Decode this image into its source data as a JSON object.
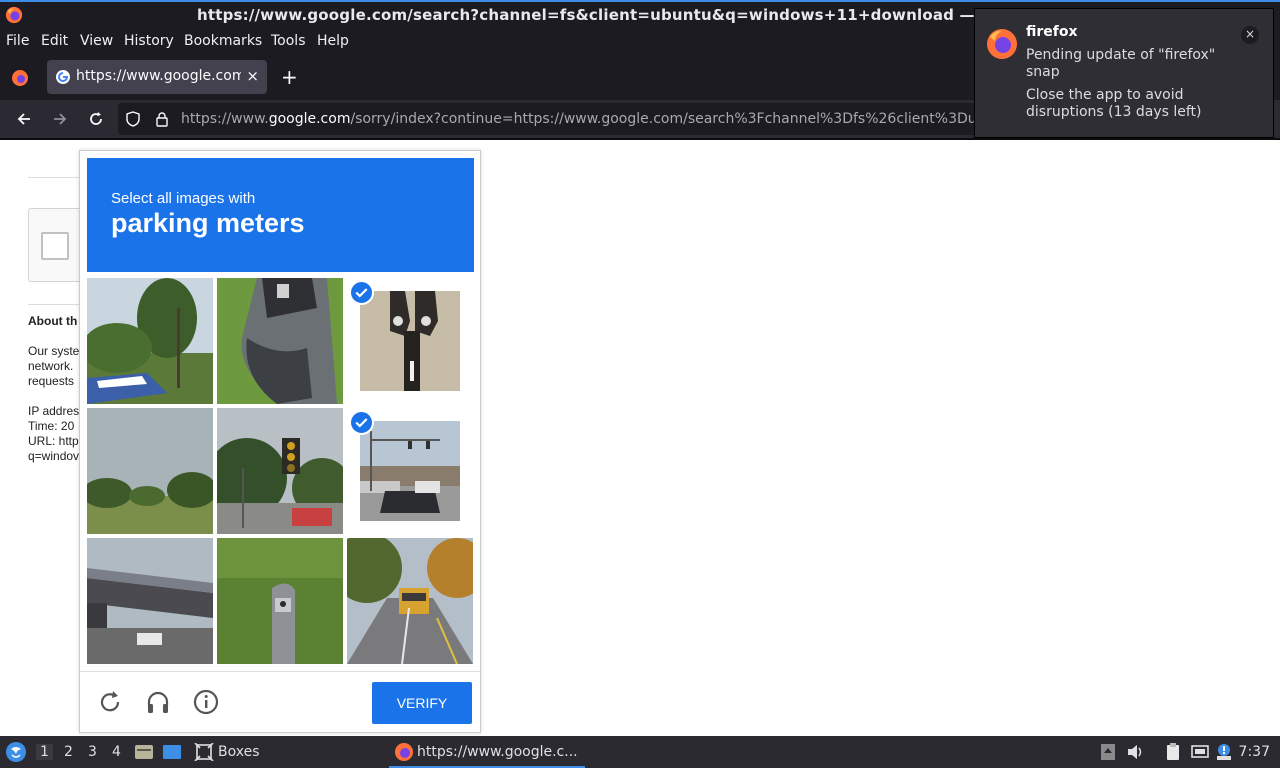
{
  "window": {
    "title": "https://www.google.com/search?channel=fs&client=ubuntu&q=windows+11+download — M"
  },
  "menu": {
    "items": [
      "File",
      "Edit",
      "View",
      "History",
      "Bookmarks",
      "Tools",
      "Help"
    ]
  },
  "tabs": [
    {
      "title": "https://www.google.com/sorry/index",
      "close": "×"
    }
  ],
  "newtab": "+",
  "urlbar": {
    "prefix": "https://www.",
    "domain": "google.com",
    "suffix": "/sorry/index?continue=https://www.google.com/search%3Fchannel%3Dfs%26client%3Du"
  },
  "page": {
    "about_heading": "About th",
    "para_lines": [
      "Our syste",
      "network.",
      "requests"
    ],
    "info_lines": [
      "IP addres",
      "Time: 20",
      "URL: http",
      "q=windov"
    ]
  },
  "challenge": {
    "instruction": "Select all images with",
    "target": "parking meters",
    "tiles": [
      {
        "id": "t1",
        "label": "tree-with-boat",
        "selected": false
      },
      {
        "id": "t2",
        "label": "parking-meter-closeup",
        "selected": false
      },
      {
        "id": "t3",
        "label": "parking-meter-double",
        "selected": true
      },
      {
        "id": "t4",
        "label": "field-sky",
        "selected": false
      },
      {
        "id": "t5",
        "label": "traffic-light",
        "selected": false
      },
      {
        "id": "t6",
        "label": "intersection-cars",
        "selected": true
      },
      {
        "id": "t7",
        "label": "bridge",
        "selected": false
      },
      {
        "id": "t8",
        "label": "parking-meter-grass",
        "selected": false
      },
      {
        "id": "t9",
        "label": "road-school-bus",
        "selected": false
      }
    ],
    "verify_label": "VERIFY",
    "footer_icons": [
      "reload-icon",
      "headphones-icon",
      "info-icon"
    ]
  },
  "notification": {
    "app": "firefox",
    "body": "Pending update of \"firefox\" snap",
    "body2": "Close the app to avoid disruptions (13 days left)",
    "close": "×"
  },
  "taskbar": {
    "workspaces": [
      "1",
      "2",
      "3",
      "4"
    ],
    "boxes_label": "Boxes",
    "task_label": "https://www.google.c...",
    "clock": "7:37"
  },
  "colors": {
    "accent": "#1a73e8",
    "titlebar": "#1c1b22",
    "taskbar": "#2a2a30"
  }
}
